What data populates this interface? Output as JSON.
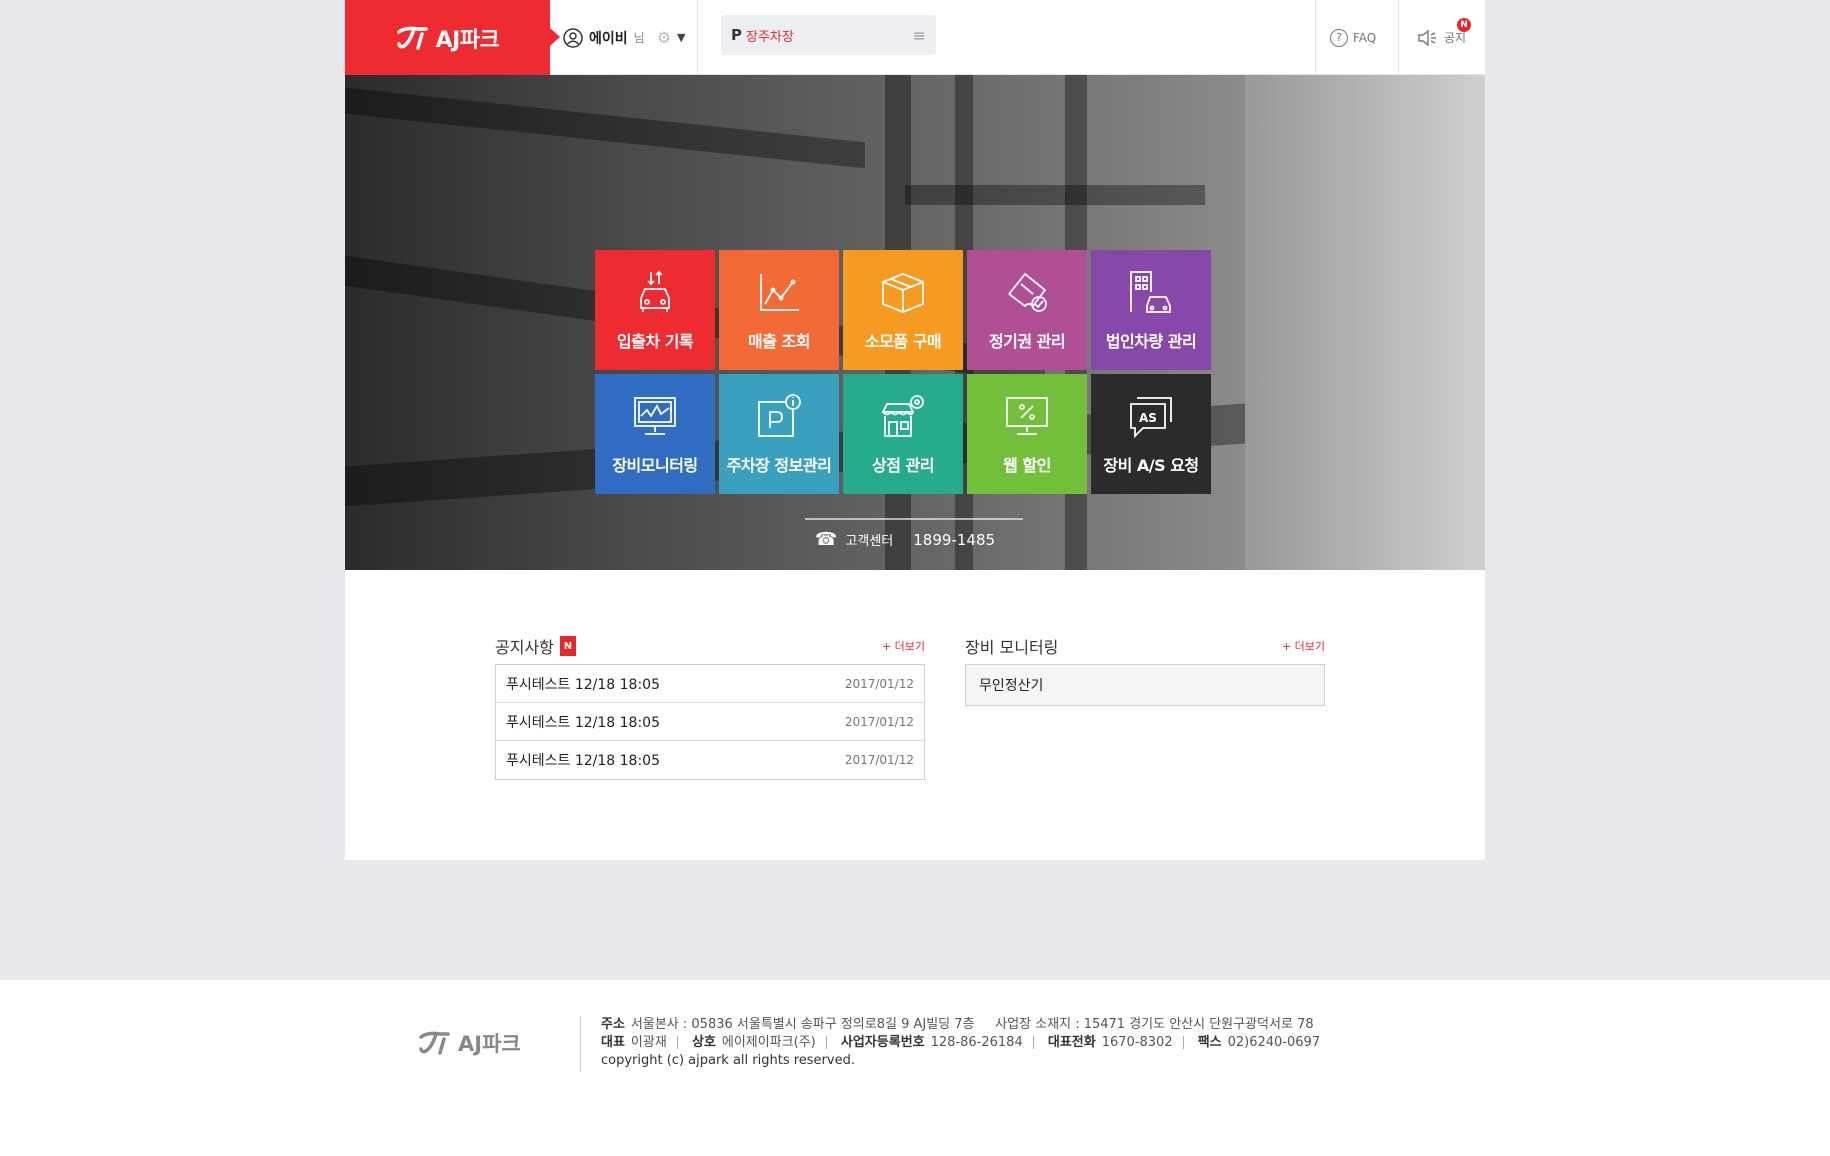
{
  "header": {
    "logo_text": "AJ파크",
    "user_name": "에이비",
    "user_suffix": "님",
    "lot_prefix": "P",
    "lot_name": "장주차장",
    "faq_label": "FAQ",
    "notice_label": "공지",
    "notice_badge": "N"
  },
  "menu": {
    "row1": [
      {
        "label": "입출차 기록",
        "color": "#ee2b30",
        "icon": "car-in-out-icon"
      },
      {
        "label": "매출 조회",
        "color": "#f26a35",
        "icon": "sales-chart-icon"
      },
      {
        "label": "소모품 구매",
        "color": "#f79a21",
        "icon": "box-icon"
      },
      {
        "label": "정기권 관리",
        "color": "#b04f94",
        "icon": "ticket-check-icon"
      },
      {
        "label": "법인차량 관리",
        "color": "#8648a9",
        "icon": "building-car-icon"
      }
    ],
    "row2": [
      {
        "label": "장비모니터링",
        "color": "#2f6cc2",
        "icon": "monitor-icon"
      },
      {
        "label": "주차장 정보관리",
        "color": "#3aa0c0",
        "icon": "parking-info-icon"
      },
      {
        "label": "상점 관리",
        "color": "#26ab8c",
        "icon": "store-gear-icon"
      },
      {
        "label": "웹 할인",
        "color": "#73bf3b",
        "icon": "percent-monitor-icon"
      },
      {
        "label": "장비 A/S 요청",
        "color": "#2b2b2b",
        "icon": "as-chat-icon"
      }
    ]
  },
  "customer_center": {
    "label": "고객센터",
    "number": "1899-1485"
  },
  "notice": {
    "title": "공지사항",
    "badge": "N",
    "more": "+ 더보기",
    "items": [
      {
        "title": "푸시테스트 12/18 18:05",
        "date": "2017/01/12"
      },
      {
        "title": "푸시테스트 12/18 18:05",
        "date": "2017/01/12"
      },
      {
        "title": "푸시테스트 12/18 18:05",
        "date": "2017/01/12"
      }
    ]
  },
  "monitoring": {
    "title": "장비 모니터링",
    "more": "+ 더보기",
    "items": [
      "무인정산기"
    ]
  },
  "footer": {
    "logo_text": "AJ파크",
    "addr_label": "주소",
    "addr_value": "서울본사 : 05836 서울특별시 송파구 정의로8길 9 AJ빌딩 7층",
    "site_value": "사업장 소재지 : 15471 경기도 안산시 단원구광덕서로 78",
    "ceo_label": "대표",
    "ceo_value": "이광재",
    "company_label": "상호",
    "company_value": "에이제이파크(주)",
    "bizno_label": "사업자등록번호",
    "bizno_value": "128-86-26184",
    "tel_label": "대표전화",
    "tel_value": "1670-8302",
    "fax_label": "팩스",
    "fax_value": "02)6240-0697",
    "copyright": "copyright (c) ajpark all rights reserved."
  }
}
